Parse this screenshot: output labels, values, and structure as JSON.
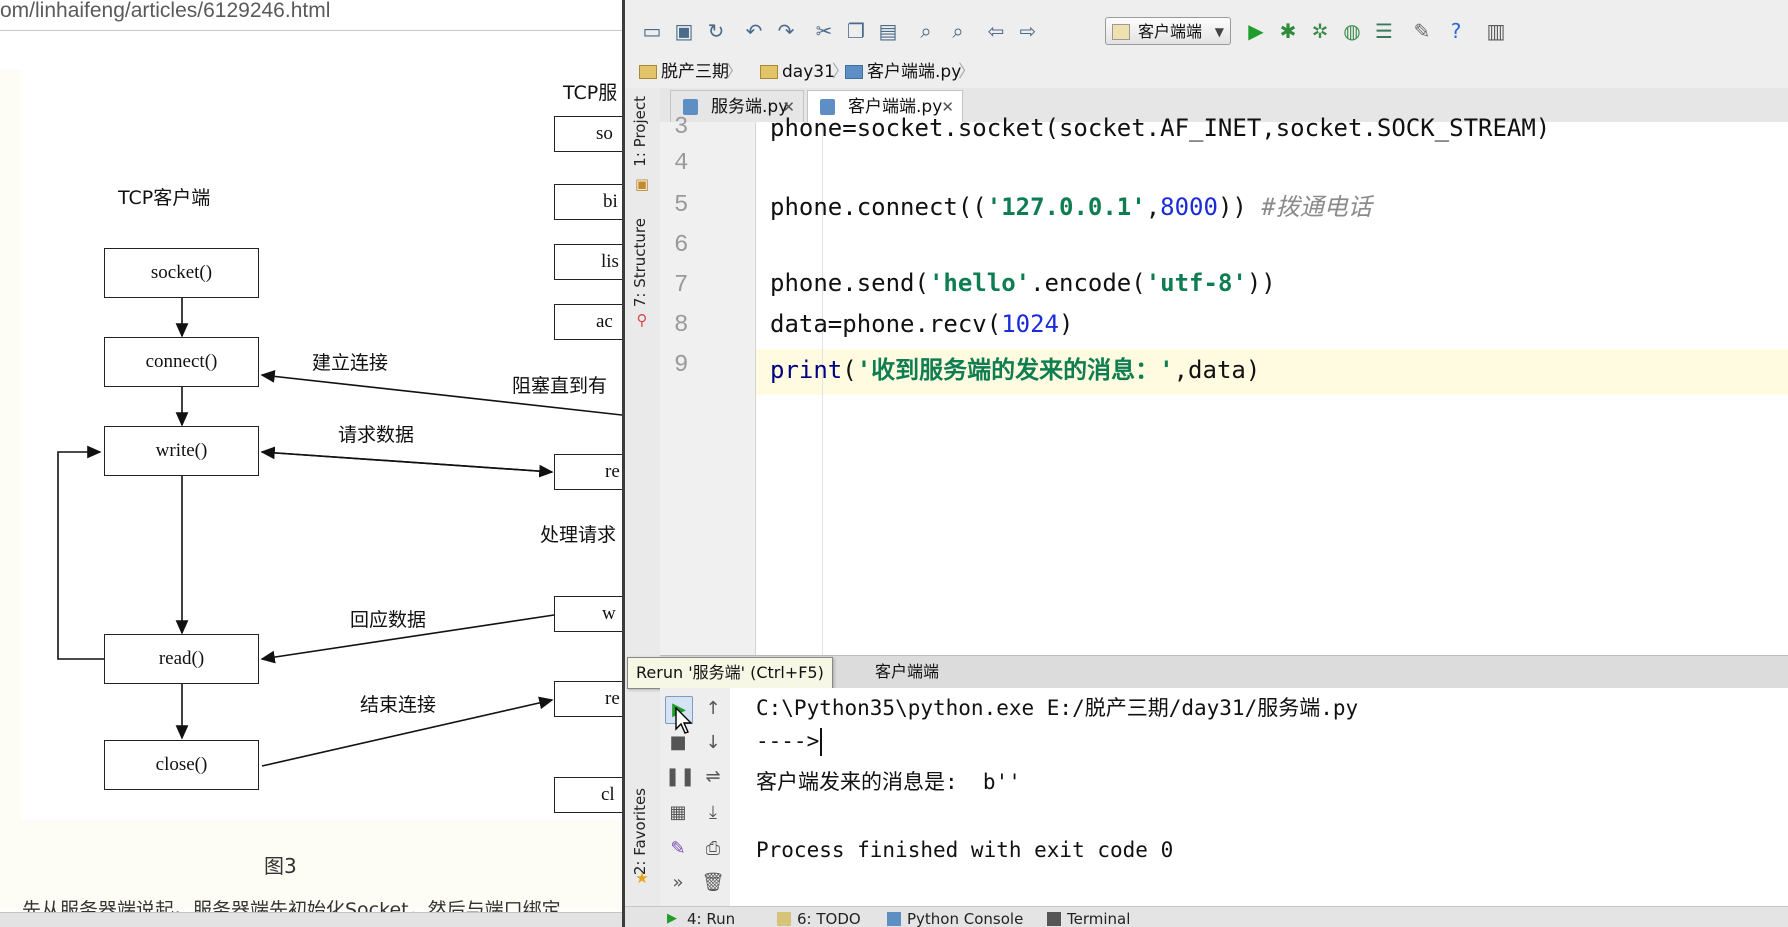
{
  "browser": {
    "url": "om/linhaifeng/articles/6129246.html",
    "figure_caption": "图3",
    "article_text": "先从服务器端说起。服务器端先初始化Socket，然后与端口绑定"
  },
  "diagram": {
    "client_title": "TCP客户端",
    "server_title": "TCP服",
    "client_boxes": [
      "socket()",
      "connect()",
      "write()",
      "read()",
      "close()"
    ],
    "server_boxes": [
      "so",
      "bi",
      "lis",
      "ac",
      "re",
      "w",
      "re",
      "cl"
    ],
    "labels": {
      "establish": "建立连接",
      "blocked": "阻塞直到有",
      "request": "请求数据",
      "process": "处理请求",
      "reply": "回应数据",
      "close": "结束连接"
    }
  },
  "ide": {
    "run_config": "客户端端",
    "breadcrumbs": [
      "脱产三期",
      "day31",
      "客户端端.py"
    ],
    "tabs": [
      {
        "label": "服务端.py",
        "active": false
      },
      {
        "label": "客户端端.py",
        "active": true
      }
    ],
    "side_tabs": [
      "1: Project",
      "7: Structure",
      "2: Favorites"
    ],
    "code": {
      "line_numbers": [
        "3",
        "4",
        "5",
        "6",
        "7",
        "8",
        "9"
      ],
      "l3": "phone=socket.socket(socket.AF_INET,socket.SOCK_STREAM)",
      "l5_pre": "phone.connect((",
      "l5_str": "'127.0.0.1'",
      "l5_comma": ",",
      "l5_num": "8000",
      "l5_post": ")) ",
      "l5_comment": "#拨通电话",
      "l7_pre": "phone.send(",
      "l7_str": "'hello'",
      "l7_mid": ".encode(",
      "l7_str2": "'utf-8'",
      "l7_post": "))",
      "l8_pre": "data=phone.recv(",
      "l8_num": "1024",
      "l8_post": ")",
      "l9_kw": "print",
      "l9_paren": "(",
      "l9_str": "'收到服务端的发来的消息：'",
      "l9_post": ",data)"
    },
    "run_panel": {
      "tooltip": "Rerun '服务端' (Ctrl+F5)",
      "tab_label": "客户端端",
      "console": [
        "C:\\Python35\\python.exe E:/脱产三期/day31/服务端.py",
        "---->",
        "客户端发来的消息是:  b''",
        "Process finished with exit code 0"
      ]
    },
    "bottom_tabs": [
      "4: Run",
      "6: TODO",
      "Python Console",
      "Terminal"
    ],
    "colors": {
      "string": "#0e7d51",
      "number": "#1a2bd8",
      "comment": "#8b8b8b",
      "run_green": "#1f9d2d"
    }
  }
}
